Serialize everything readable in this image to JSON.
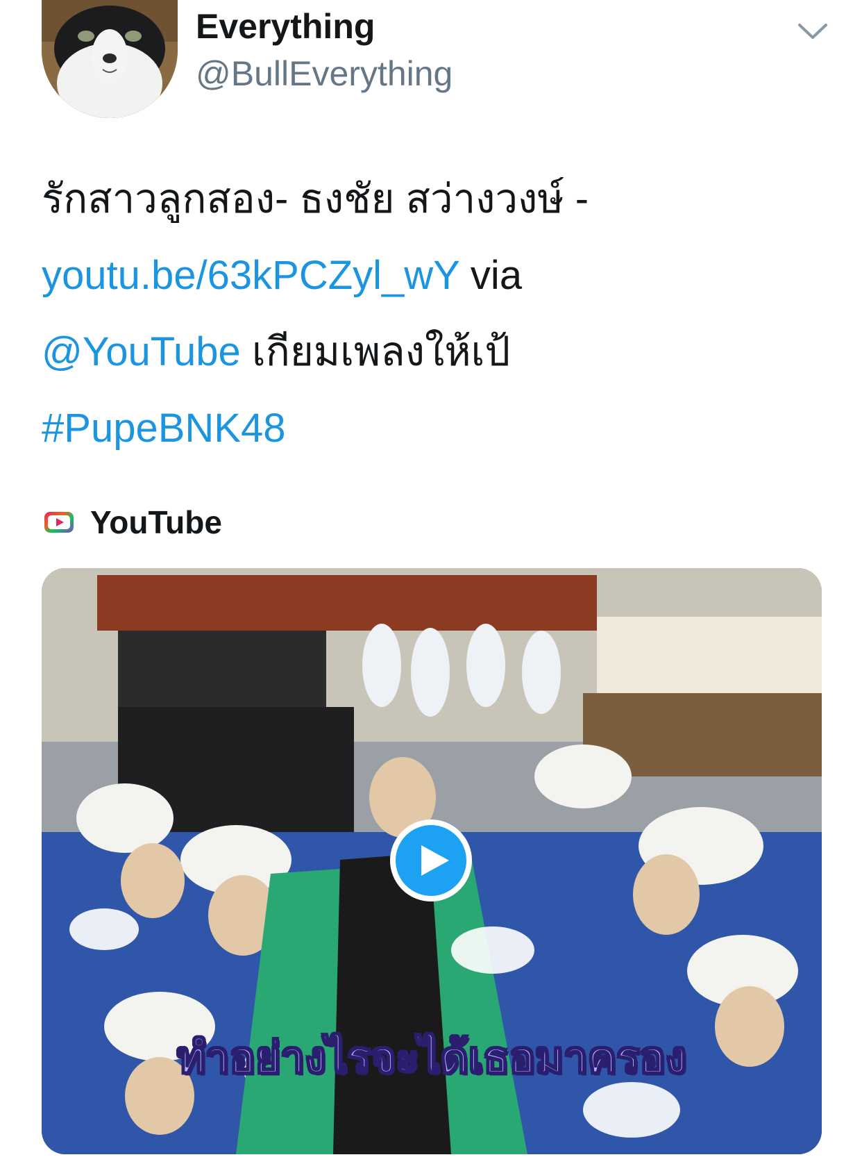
{
  "tweet": {
    "author": {
      "display_name": "Everything",
      "handle": "@BullEverything",
      "avatar_icon": "cat-avatar"
    },
    "menu_icon": "chevron-down-icon",
    "text_lines": {
      "line1": "รักสาวลูกสอง- ธงชัย สว่างวงษ์ -",
      "link_url": "youtu.be/63kPCZyl_wY",
      "via_text": " via",
      "mention": "@YouTube",
      "line3_text": " เกียมเพลงให้เป้",
      "hashtag": "#PupeBNK48"
    },
    "card": {
      "source_label": "YouTube",
      "source_icon": "youtube-logo-icon",
      "play_icon": "play-icon",
      "video_subtitle": "ทำอย่างไรจะได้เธอมาครอง"
    }
  },
  "colors": {
    "link": "#1b95e0",
    "text": "#14171a",
    "secondary": "#657786",
    "play_button": "#1da1f2"
  }
}
